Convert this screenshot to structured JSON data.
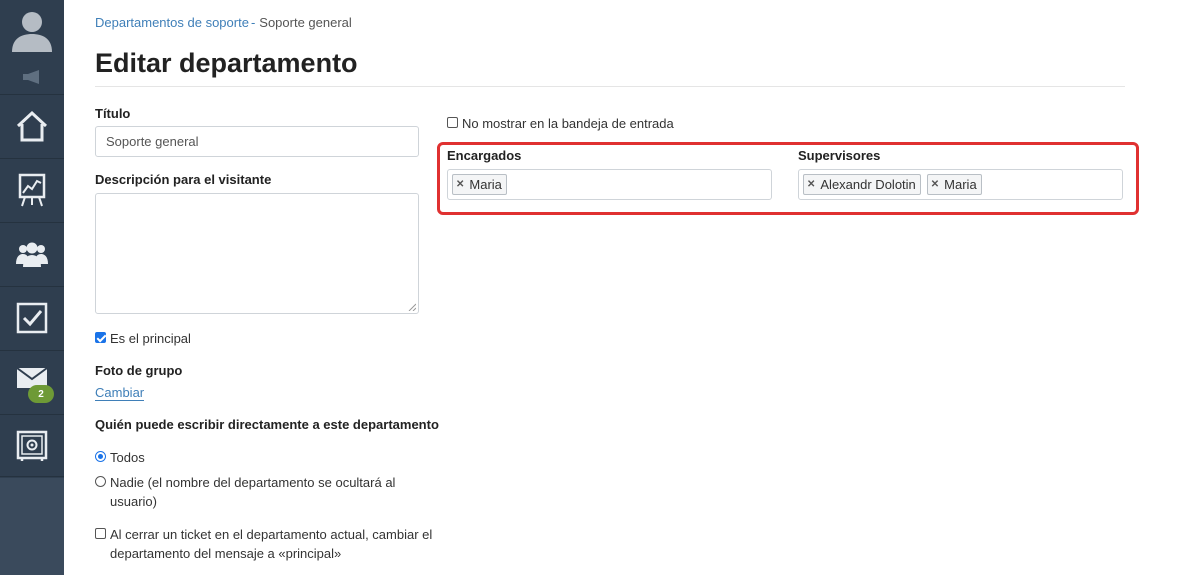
{
  "breadcrumb": {
    "parent": "Departamentos de soporte",
    "separator": "-",
    "current": "Soporte general"
  },
  "page_title": "Editar departamento",
  "form": {
    "title_label": "Título",
    "title_value": "Soporte general",
    "description_label": "Descripción para el visitante",
    "description_value": "",
    "is_main_label": "Es el principal",
    "is_main_checked": true,
    "group_photo_label": "Foto de grupo",
    "change_link": "Cambiar",
    "who_can_write_label": "Quién puede escribir directamente a este departamento",
    "radio_all": "Todos",
    "radio_nobody_line1": "Nadie (el nombre del departamento se ocultará al",
    "radio_nobody_line2": "usuario)",
    "close_ticket_line1": "Al cerrar un ticket en el departamento actual, cambiar el",
    "close_ticket_line2": "departamento del mensaje a «principal»",
    "hide_inbox_label": "No mostrar en la bandeja de entrada"
  },
  "assignees": {
    "label": "Encargados",
    "tags": [
      "Maria"
    ]
  },
  "supervisors": {
    "label": "Supervisores",
    "tags": [
      "Alexandr Dolotin",
      "Maria"
    ]
  },
  "sidebar": {
    "items": [
      "home-icon",
      "chart-icon",
      "users-icon",
      "tasks-icon",
      "mail-icon",
      "safe-icon"
    ],
    "mail_badge": "2"
  },
  "colors": {
    "sidebar": "#2f3e4f",
    "link": "#3f7fb8",
    "highlight": "#e03131",
    "badge": "#6e9a36"
  }
}
